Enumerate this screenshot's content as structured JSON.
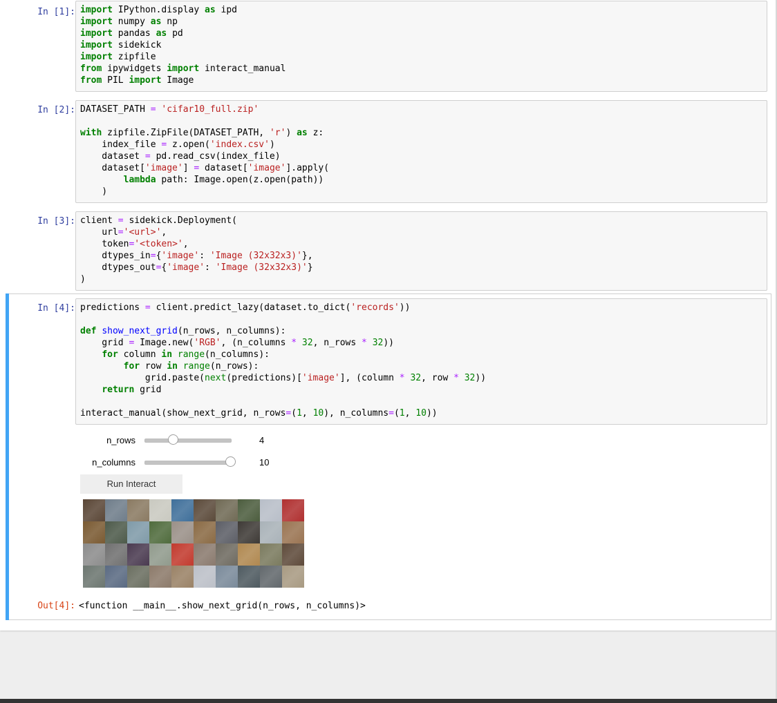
{
  "cells": [
    {
      "prompt": "In [1]:",
      "lines": [
        [
          [
            "kw",
            "import"
          ],
          [
            "t",
            " IPython.display "
          ],
          [
            "kw",
            "as"
          ],
          [
            "t",
            " ipd"
          ]
        ],
        [
          [
            "kw",
            "import"
          ],
          [
            "t",
            " numpy "
          ],
          [
            "kw",
            "as"
          ],
          [
            "t",
            " np"
          ]
        ],
        [
          [
            "kw",
            "import"
          ],
          [
            "t",
            " pandas "
          ],
          [
            "kw",
            "as"
          ],
          [
            "t",
            " pd"
          ]
        ],
        [
          [
            "kw",
            "import"
          ],
          [
            "t",
            " sidekick"
          ]
        ],
        [
          [
            "kw",
            "import"
          ],
          [
            "t",
            " zipfile"
          ]
        ],
        [
          [
            "kw",
            "from"
          ],
          [
            "t",
            " ipywidgets "
          ],
          [
            "kw",
            "import"
          ],
          [
            "t",
            " interact_manual"
          ]
        ],
        [
          [
            "kw",
            "from"
          ],
          [
            "t",
            " PIL "
          ],
          [
            "kw",
            "import"
          ],
          [
            "t",
            " Image"
          ]
        ]
      ]
    },
    {
      "prompt": "In [2]:",
      "lines": [
        [
          [
            "t",
            "DATASET_PATH "
          ],
          [
            "op",
            "="
          ],
          [
            "t",
            " "
          ],
          [
            "str",
            "'cifar10_full.zip'"
          ]
        ],
        [],
        [
          [
            "kw",
            "with"
          ],
          [
            "t",
            " zipfile.ZipFile(DATASET_PATH, "
          ],
          [
            "str",
            "'r'"
          ],
          [
            "t",
            ") "
          ],
          [
            "kw",
            "as"
          ],
          [
            "t",
            " z:"
          ]
        ],
        [
          [
            "t",
            "    index_file "
          ],
          [
            "op",
            "="
          ],
          [
            "t",
            " z.open("
          ],
          [
            "str",
            "'index.csv'"
          ],
          [
            "t",
            ")"
          ]
        ],
        [
          [
            "t",
            "    dataset "
          ],
          [
            "op",
            "="
          ],
          [
            "t",
            " pd.read_csv(index_file)"
          ]
        ],
        [
          [
            "t",
            "    dataset["
          ],
          [
            "str",
            "'image'"
          ],
          [
            "t",
            "] "
          ],
          [
            "op",
            "="
          ],
          [
            "t",
            " dataset["
          ],
          [
            "str",
            "'image'"
          ],
          [
            "t",
            "].apply("
          ]
        ],
        [
          [
            "t",
            "        "
          ],
          [
            "kw",
            "lambda"
          ],
          [
            "t",
            " path: Image.open(z.open(path))"
          ]
        ],
        [
          [
            "t",
            "    )"
          ]
        ]
      ]
    },
    {
      "prompt": "In [3]:",
      "lines": [
        [
          [
            "t",
            "client "
          ],
          [
            "op",
            "="
          ],
          [
            "t",
            " sidekick.Deployment("
          ]
        ],
        [
          [
            "t",
            "    url"
          ],
          [
            "op",
            "="
          ],
          [
            "str",
            "'<url>'"
          ],
          [
            "t",
            ","
          ]
        ],
        [
          [
            "t",
            "    token"
          ],
          [
            "op",
            "="
          ],
          [
            "str",
            "'<token>'"
          ],
          [
            "t",
            ","
          ]
        ],
        [
          [
            "t",
            "    dtypes_in"
          ],
          [
            "op",
            "="
          ],
          [
            "t",
            "{"
          ],
          [
            "str",
            "'image'"
          ],
          [
            "t",
            ": "
          ],
          [
            "str",
            "'Image (32x32x3)'"
          ],
          [
            "t",
            "},"
          ]
        ],
        [
          [
            "t",
            "    dtypes_out"
          ],
          [
            "op",
            "="
          ],
          [
            "t",
            "{"
          ],
          [
            "str",
            "'image'"
          ],
          [
            "t",
            ": "
          ],
          [
            "str",
            "'Image (32x32x3)'"
          ],
          [
            "t",
            "}"
          ]
        ],
        [
          [
            "t",
            ")"
          ]
        ]
      ]
    },
    {
      "prompt": "In [4]:",
      "lines": [
        [
          [
            "t",
            "predictions "
          ],
          [
            "op",
            "="
          ],
          [
            "t",
            " client.predict_lazy(dataset.to_dict("
          ],
          [
            "str",
            "'records'"
          ],
          [
            "t",
            "))"
          ]
        ],
        [],
        [
          [
            "kw",
            "def"
          ],
          [
            "t",
            " "
          ],
          [
            "fn",
            "show_next_grid"
          ],
          [
            "t",
            "(n_rows, n_columns):"
          ]
        ],
        [
          [
            "t",
            "    grid "
          ],
          [
            "op",
            "="
          ],
          [
            "t",
            " Image.new("
          ],
          [
            "str",
            "'RGB'"
          ],
          [
            "t",
            ", (n_columns "
          ],
          [
            "op",
            "*"
          ],
          [
            "t",
            " "
          ],
          [
            "num",
            "32"
          ],
          [
            "t",
            ", n_rows "
          ],
          [
            "op",
            "*"
          ],
          [
            "t",
            " "
          ],
          [
            "num",
            "32"
          ],
          [
            "t",
            "))"
          ]
        ],
        [
          [
            "t",
            "    "
          ],
          [
            "kw",
            "for"
          ],
          [
            "t",
            " column "
          ],
          [
            "kw",
            "in"
          ],
          [
            "t",
            " "
          ],
          [
            "bi",
            "range"
          ],
          [
            "t",
            "(n_columns):"
          ]
        ],
        [
          [
            "t",
            "        "
          ],
          [
            "kw",
            "for"
          ],
          [
            "t",
            " row "
          ],
          [
            "kw",
            "in"
          ],
          [
            "t",
            " "
          ],
          [
            "bi",
            "range"
          ],
          [
            "t",
            "(n_rows):"
          ]
        ],
        [
          [
            "t",
            "            grid.paste("
          ],
          [
            "bi",
            "next"
          ],
          [
            "t",
            "(predictions)["
          ],
          [
            "str",
            "'image'"
          ],
          [
            "t",
            "], (column "
          ],
          [
            "op",
            "*"
          ],
          [
            "t",
            " "
          ],
          [
            "num",
            "32"
          ],
          [
            "t",
            ", row "
          ],
          [
            "op",
            "*"
          ],
          [
            "t",
            " "
          ],
          [
            "num",
            "32"
          ],
          [
            "t",
            "))"
          ]
        ],
        [
          [
            "t",
            "    "
          ],
          [
            "kw",
            "return"
          ],
          [
            "t",
            " grid"
          ]
        ],
        [],
        [
          [
            "t",
            "interact_manual(show_next_grid, n_rows"
          ],
          [
            "op",
            "="
          ],
          [
            "t",
            "("
          ],
          [
            "num",
            "1"
          ],
          [
            "t",
            ", "
          ],
          [
            "num",
            "10"
          ],
          [
            "t",
            "), n_columns"
          ],
          [
            "op",
            "="
          ],
          [
            "t",
            "("
          ],
          [
            "num",
            "1"
          ],
          [
            "t",
            ", "
          ],
          [
            "num",
            "10"
          ],
          [
            "t",
            "))"
          ]
        ]
      ]
    }
  ],
  "widgets": {
    "n_rows": {
      "label": "n_rows",
      "value": "4",
      "min": 1,
      "max": 10,
      "level": 4
    },
    "n_columns": {
      "label": "n_columns",
      "value": "10",
      "min": 1,
      "max": 10,
      "level": 10
    },
    "run_button": "Run Interact"
  },
  "output": {
    "prompt": "Out[4]:",
    "text": "<function __main__.show_next_grid(n_rows, n_columns)>"
  },
  "image_grid": {
    "rows": 4,
    "columns": 10,
    "tile_colors": [
      "#5a4636",
      "#6f7d8a",
      "#8a7a62",
      "#c9c9c0",
      "#3f6f9a",
      "#5b4a3a",
      "#706a55",
      "#4c5d3e",
      "#b8bec8",
      "#b03030",
      "#7a5a32",
      "#4d5a4a",
      "#7f9aa8",
      "#4f6b3c",
      "#9a9088",
      "#8a6a44",
      "#5c5e66",
      "#3e3a36",
      "#a9b2b8",
      "#9a7452",
      "#8c8c8c",
      "#707070",
      "#4a3a50",
      "#909a8c",
      "#c23a2e",
      "#8a7a6e",
      "#6e6a60",
      "#b08850",
      "#7a7a5e",
      "#5e4a3a",
      "#6c7670",
      "#5a6a82",
      "#6a6e60",
      "#8c7a6a",
      "#9a8266",
      "#bcc0c8",
      "#7a8a9a",
      "#4e5a60",
      "#62686c",
      "#a89a82"
    ]
  }
}
